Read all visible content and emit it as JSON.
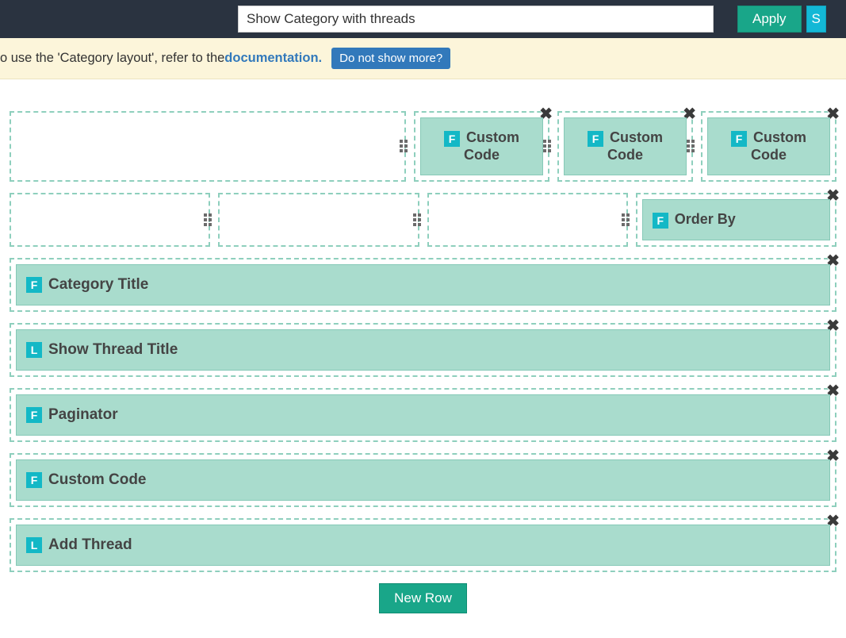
{
  "header": {
    "title_value": "Show Category with threads",
    "apply_label": "Apply",
    "secondary_label": "S"
  },
  "notice": {
    "prefix": "o use the 'Category layout', refer to the ",
    "link_text": "documentation.",
    "dismiss_label": "Do not show more?"
  },
  "tags": {
    "F": "F",
    "L": "L"
  },
  "row1": {
    "c2": {
      "tag": "F",
      "label": "Custom Code"
    },
    "c3": {
      "tag": "F",
      "label": "Custom Code"
    },
    "c4": {
      "tag": "F",
      "label": "Custom Code"
    }
  },
  "row2": {
    "c4": {
      "tag": "F",
      "label": "Order By"
    }
  },
  "fullrows": [
    {
      "tag": "F",
      "label": "Category Title"
    },
    {
      "tag": "L",
      "label": "Show Thread Title"
    },
    {
      "tag": "F",
      "label": "Paginator"
    },
    {
      "tag": "F",
      "label": "Custom Code"
    },
    {
      "tag": "L",
      "label": "Add Thread"
    }
  ],
  "new_row_label": "New Row"
}
